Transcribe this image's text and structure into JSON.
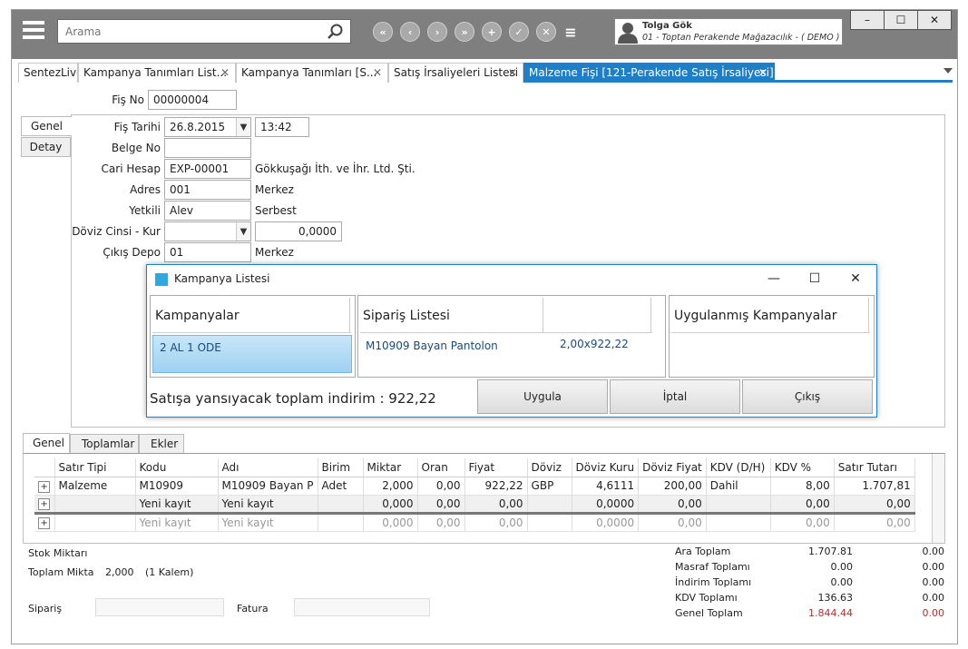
{
  "topbar": {
    "search_placeholder": "Arama",
    "nav_buttons": [
      "«",
      "‹",
      "›",
      "»",
      "+",
      "✓",
      "✕",
      "≡"
    ],
    "user_name": "Tolga Gök",
    "company": "01 - Toptan Perakende Mağazacılık - ( DEMO )",
    "window_buttons": [
      "–",
      "☐",
      "✕"
    ]
  },
  "tabs": [
    {
      "label": "SentezLive",
      "close": ""
    },
    {
      "label": "Kampanya Tanımları List...",
      "close": "✕"
    },
    {
      "label": "Kampanya Tanımları  [S...",
      "close": "✕"
    },
    {
      "label": "Satış İrsaliyeleri Listesi",
      "close": "✕"
    },
    {
      "label": "Malzeme Fişi  [121-Perakende Satış İrsaliyesi] *",
      "close": "✕"
    }
  ],
  "form": {
    "fis_no_label": "Fiş No",
    "fis_no": "00000004",
    "side_tabs": [
      "Genel",
      "Detay"
    ],
    "fis_tarihi_label": "Fiş Tarihi",
    "fis_tarihi": "26.8.2015",
    "saat": "13:42",
    "belge_no_label": "Belge No",
    "belge_no": "",
    "cari_hesap_label": "Cari Hesap",
    "cari_hesap": "EXP-00001",
    "cari_hesap_name": "Gökkuşağı İth. ve İhr. Ltd. Şti.",
    "adres_label": "Adres",
    "adres": "001",
    "adres_name": "Merkez",
    "yetkili_label": "Yetkili",
    "yetkili": "Alev",
    "yetkili_name": "Serbest",
    "doviz_label": "Döviz Cinsi - Kur",
    "doviz": "",
    "kur": "0,0000",
    "cikis_depo_label": "Çıkış Depo",
    "cikis_depo": "01",
    "cikis_depo_name": "Merkez"
  },
  "dialog": {
    "title": "Kampanya Listesi",
    "controls": [
      "—",
      "☐",
      "✕"
    ],
    "kampanyalar_header": "Kampanyalar",
    "kampanya_item": "2 AL 1 ODE",
    "siparis_header": "Sipariş Listesi",
    "siparis_item_name": "M10909 Bayan Pantolon",
    "siparis_item_value": "2,00x922,22",
    "uygulanmis_header": "Uygulanmış Kampanyalar",
    "footer_text": "Satışa yansıyacak toplam indirim : 922,22",
    "btn_uygula": "Uygula",
    "btn_iptal": "İptal",
    "btn_cikis": "Çıkış"
  },
  "bottom_tabs": [
    "Genel",
    "Toplamlar",
    "Ekler"
  ],
  "grid": {
    "columns": [
      "",
      "Satır Tipi",
      "Kodu",
      "Adı",
      "Birim",
      "Miktar",
      "Oran",
      "Fiyat",
      "Döviz",
      "Döviz Kuru",
      "Döviz Fiyat",
      "KDV (D/H)",
      "KDV %",
      "Satır Tutarı"
    ],
    "rows": [
      [
        "+",
        "Malzeme",
        "M10909",
        "M10909 Bayan P",
        "Adet",
        "2,000",
        "0,00",
        "922,22",
        "GBP",
        "4,6111",
        "200,00",
        "Dahil",
        "8,00",
        "1.707,81"
      ],
      [
        "+",
        "",
        "Yeni kayıt",
        "Yeni kayıt",
        "",
        "0,000",
        "0,00",
        "0,00",
        "",
        "0,0000",
        "0,00",
        "",
        "0,00",
        "0,00"
      ],
      [
        "+",
        "",
        "Yeni kayıt",
        "Yeni kayıt",
        "",
        "0,000",
        "0,00",
        "0,00",
        "",
        "0,0000",
        "0,00",
        "",
        "0,00",
        "0,00"
      ]
    ]
  },
  "summary": {
    "stok_miktari_label": "Stok Miktarı",
    "toplam_miktar_label": "Toplam Mikta",
    "toplam_miktar": "2,000",
    "kalem": "(1 Kalem)",
    "siparis_label": "Sipariş",
    "fatura_label": "Fatura"
  },
  "totals": [
    {
      "label": "Ara Toplam",
      "value": "1.707.81",
      "value2": "0.00"
    },
    {
      "label": "Masraf Toplamı",
      "value": "0.00",
      "value2": "0.00"
    },
    {
      "label": "İndirim Toplamı",
      "value": "0.00",
      "value2": "0.00"
    },
    {
      "label": "KDV Toplamı",
      "value": "136.63",
      "value2": "0.00"
    },
    {
      "label": "Genel Toplam",
      "value": "1.844.44",
      "value2": "0.00"
    }
  ],
  "colors": {
    "accent": "#1e7ec8",
    "topbar": "#7f7f7f",
    "total_red": "#c0282d"
  }
}
